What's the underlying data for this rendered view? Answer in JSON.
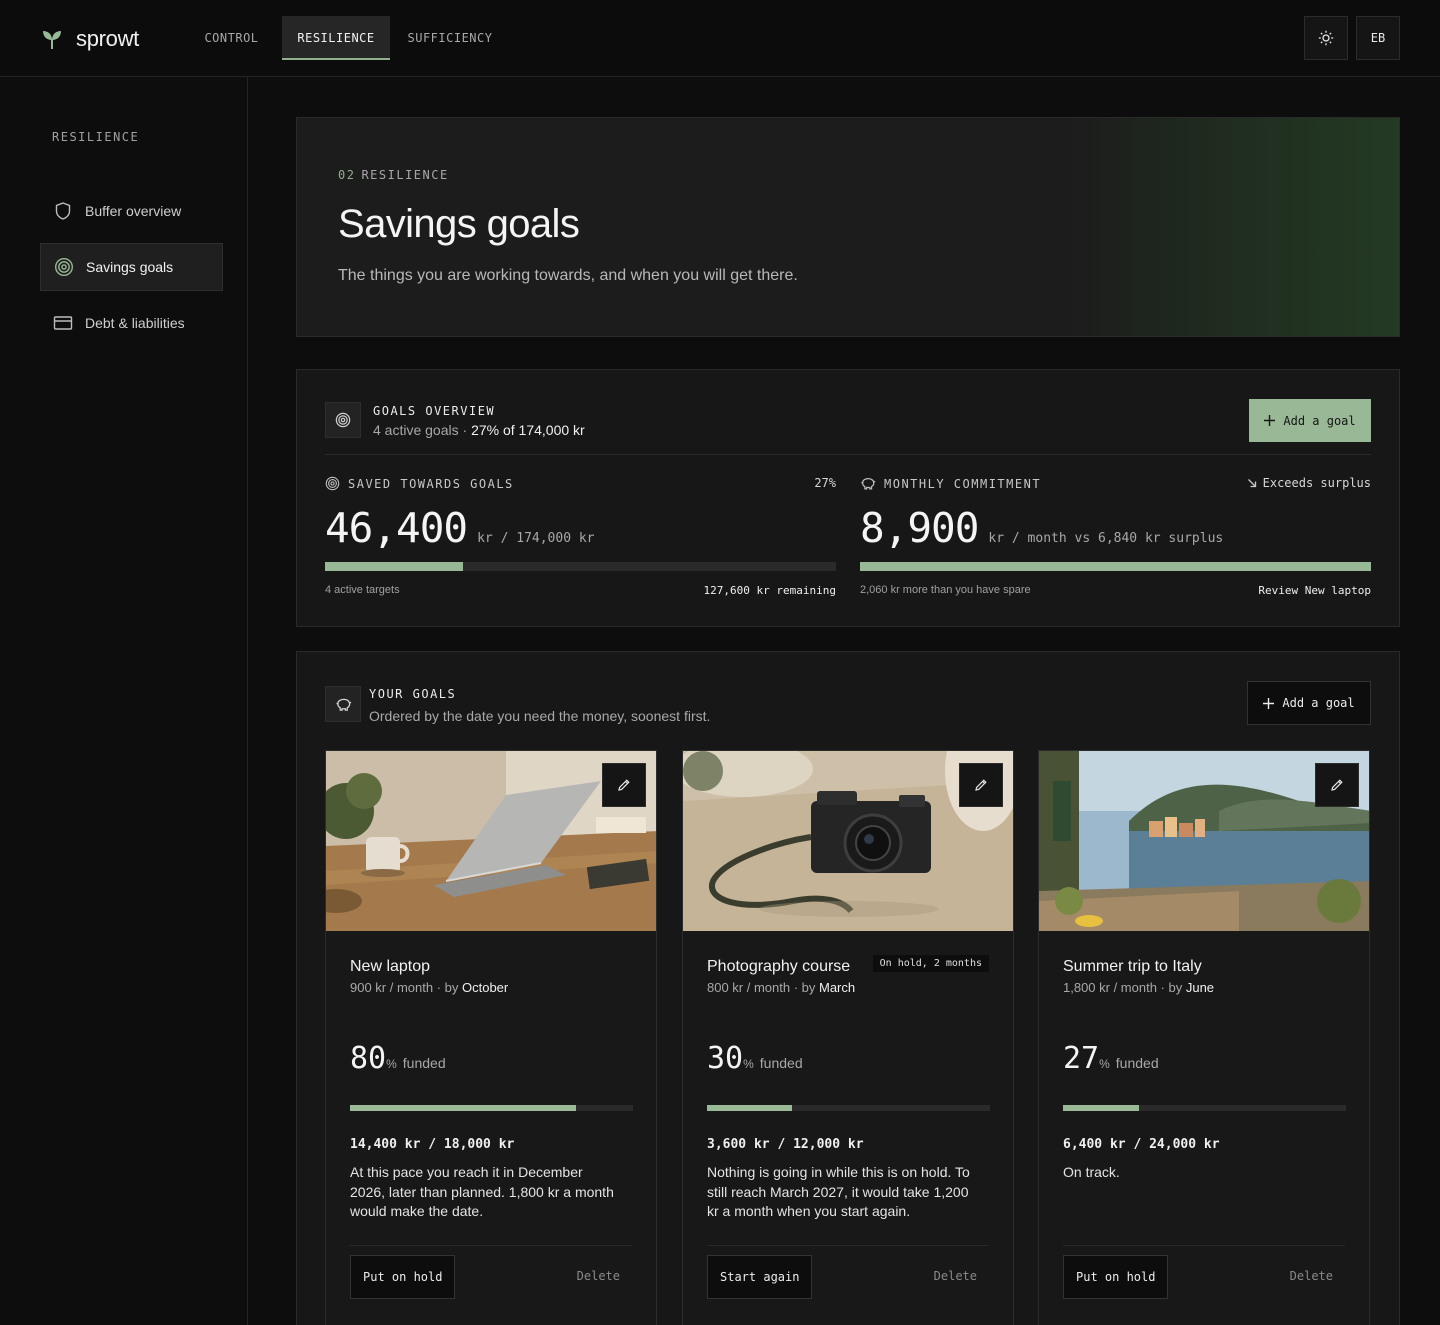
{
  "app": {
    "name": "sprowt",
    "accent": "#98b896"
  },
  "nav": {
    "tabs": [
      "CONTROL",
      "RESILIENCE",
      "SUFFICIENCY"
    ],
    "active": "RESILIENCE"
  },
  "header": {
    "theme_icon": "sun-icon",
    "avatar_initials": "EB"
  },
  "sidebar": {
    "heading": "RESILIENCE",
    "items": [
      {
        "label": "Buffer overview",
        "icon": "shield-icon"
      },
      {
        "label": "Savings goals",
        "icon": "target-icon",
        "active": true
      },
      {
        "label": "Debt & liabilities",
        "icon": "card-icon"
      }
    ]
  },
  "hero": {
    "kicker_num": "02",
    "kicker": "RESILIENCE",
    "title": "Savings goals",
    "subtitle": "The things you are working towards, and when you will get there."
  },
  "overview": {
    "title": "GOALS OVERVIEW",
    "sub_prefix": "4 active goals · ",
    "sub_strong": "27% of 174,000 kr",
    "add_label": "Add a goal",
    "saved": {
      "label": "SAVED TOWARDS GOALS",
      "percent_label": "27%",
      "value": "46,400",
      "unit": "kr  / 174,000 kr",
      "progress": 0.27,
      "foot_left": "4 active targets",
      "foot_right": "127,600 kr remaining"
    },
    "monthly": {
      "label": "MONTHLY COMMITMENT",
      "flag": "Exceeds surplus",
      "value": "8,900",
      "unit": "kr / month  vs 6,840 kr surplus",
      "progress": 1.0,
      "foot_left": "2,060 kr more than you have spare",
      "foot_right": "Review New laptop"
    }
  },
  "goals_panel": {
    "title": "YOUR GOALS",
    "subtitle": "Ordered by the date you need the money, soonest first.",
    "add_label": "Add a goal"
  },
  "goals": [
    {
      "name": "New laptop",
      "meta_prefix": "900 kr / month · by ",
      "meta_month": "October",
      "badge": "",
      "percent": "80",
      "progress": 0.8,
      "amount": "14,400 kr / 18,000 kr",
      "note": "At this pace you reach it in December 2026, later than planned. 1,800 kr a month would make the date.",
      "action": "Put on hold",
      "delete": "Delete"
    },
    {
      "name": "Photography course",
      "meta_prefix": "800 kr / month · by ",
      "meta_month": "March",
      "badge": "On hold, 2 months",
      "percent": "30",
      "progress": 0.3,
      "amount": "3,600 kr / 12,000 kr",
      "note": "Nothing is going in while this is on hold. To still reach March 2027, it would take 1,200 kr a month when you start again.",
      "action": "Start again",
      "delete": "Delete"
    },
    {
      "name": "Summer trip to Italy",
      "meta_prefix": "1,800 kr / month · by ",
      "meta_month": "June",
      "badge": "",
      "percent": "27",
      "progress": 0.27,
      "amount": "6,400 kr / 24,000 kr",
      "note": "On track.",
      "action": "Put on hold",
      "delete": "Delete"
    }
  ],
  "labels": {
    "percent_sign": "%",
    "funded": "funded"
  }
}
